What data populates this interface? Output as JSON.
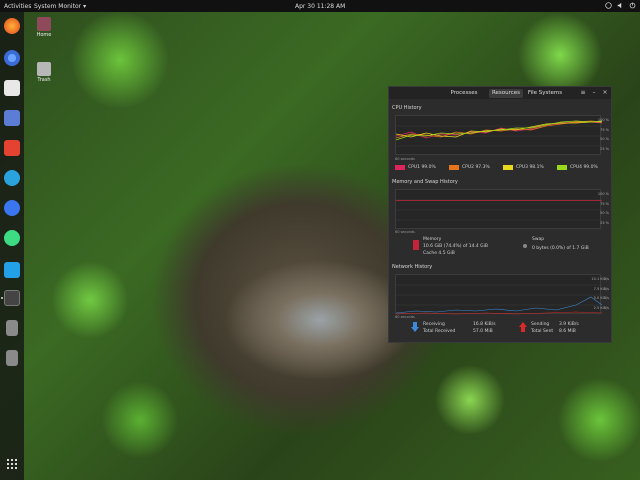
{
  "topbar": {
    "activities": "Activities",
    "app_menu": "System Monitor",
    "clock": "Apr 30  11:28 AM"
  },
  "desktop_icons": [
    {
      "label": "Home"
    },
    {
      "label": "Trash"
    }
  ],
  "window": {
    "tabs": [
      "Processes",
      "Resources",
      "File Systems"
    ],
    "active_tab": "Resources",
    "cpu": {
      "title": "CPU History",
      "y_labels": [
        "100 %",
        "75 %",
        "50 %",
        "25 %",
        "0 %"
      ],
      "x_start": "60 seconds",
      "legend": [
        {
          "label": "CPU1  99.0%",
          "color": "#e0245e"
        },
        {
          "label": "CPU2  97.3%",
          "color": "#e8741c"
        },
        {
          "label": "CPU3  98.1%",
          "color": "#e8d81c"
        },
        {
          "label": "CPU4  99.0%",
          "color": "#9ad81c"
        }
      ]
    },
    "memory": {
      "title": "Memory and Swap History",
      "y_labels": [
        "100 %",
        "75 %",
        "50 %",
        "25 %",
        "0 %"
      ],
      "x_start": "60 seconds",
      "memory_label": "Memory",
      "memory_value": "10.6 GiB (74.4%) of 14.4 GiB",
      "cache_value": "Cache 4.5 GiB",
      "swap_label": "Swap",
      "swap_value": "0 bytes (0.0%) of 1.7 GiB",
      "memory_color": "#c4243a",
      "swap_color": "#888888"
    },
    "network": {
      "title": "Network History",
      "y_labels": [
        "10.1 KiB/s",
        "7.5 KiB/s",
        "5.0 KiB/s",
        "2.5 KiB/s",
        "0 bytes/s"
      ],
      "x_start": "60 seconds",
      "receiving_label": "Receiving",
      "receiving_value": "16.8 KiB/s",
      "total_received_label": "Total Received",
      "total_received_value": "57.0 MiB",
      "sending_label": "Sending",
      "sending_value": "3.9 KiB/s",
      "total_sent_label": "Total Sent",
      "total_sent_value": "8.6 MiB",
      "receiving_color": "#3f8ad8",
      "sending_color": "#d82a2a"
    }
  },
  "dock": {
    "icons": [
      "firefox-icon",
      "chrome-icon",
      "files-icon",
      "mail-icon",
      "todoist-icon",
      "telegram-icon",
      "signal-icon",
      "android-studio-icon",
      "vscode-icon",
      "system-monitor-icon",
      "drive-icon",
      "drive-icon-2",
      "app-grid-icon"
    ]
  }
}
